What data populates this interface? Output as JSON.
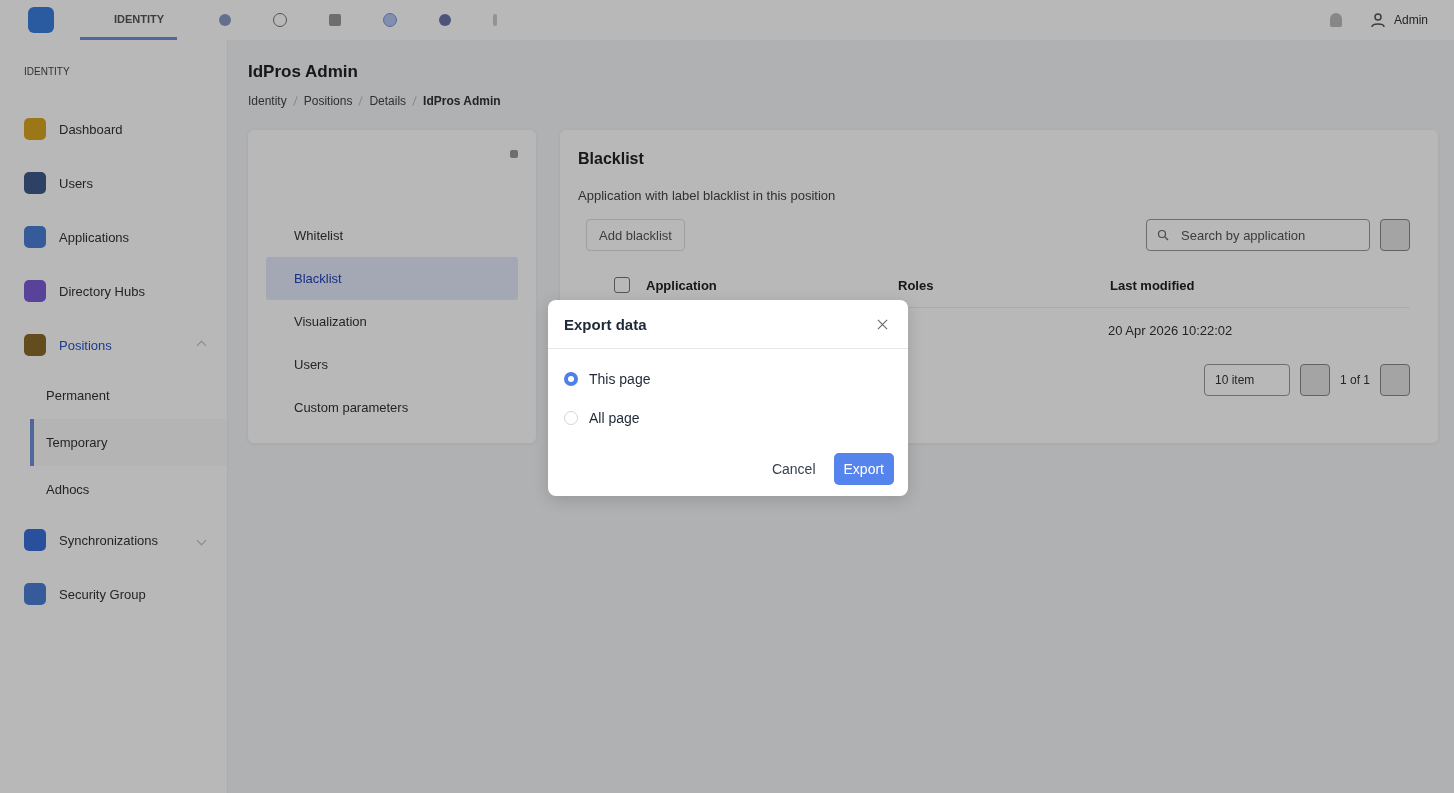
{
  "topbar": {
    "tabs": [
      {
        "label": "IDENTITY",
        "selected": true
      }
    ],
    "user": "Admin"
  },
  "sidebar": {
    "section": "IDENTITY",
    "items": [
      {
        "label": "Dashboard",
        "selected": false
      },
      {
        "label": "Users",
        "selected": false
      },
      {
        "label": "Applications",
        "selected": false
      },
      {
        "label": "Directory Hubs",
        "selected": false
      },
      {
        "label": "Positions",
        "selected": true,
        "expanded": true,
        "children": [
          {
            "label": "Permanent",
            "selected": false
          },
          {
            "label": "Temporary",
            "selected": true
          },
          {
            "label": "Adhocs",
            "selected": false
          }
        ]
      },
      {
        "label": "Synchronizations",
        "selected": false,
        "expanded": false
      },
      {
        "label": "Security Group",
        "selected": false
      }
    ]
  },
  "page": {
    "title": "IdPros Admin",
    "breadcrumb": [
      "Identity",
      "Positions",
      "Details",
      "IdPros Admin"
    ]
  },
  "detail_menu": {
    "items": [
      {
        "label": "Whitelist",
        "selected": false
      },
      {
        "label": "Blacklist",
        "selected": true
      },
      {
        "label": "Visualization",
        "selected": false
      },
      {
        "label": "Users",
        "selected": false
      },
      {
        "label": "Custom parameters",
        "selected": false
      }
    ]
  },
  "blacklist": {
    "title": "Blacklist",
    "subtitle": "Application with label blacklist in this position",
    "add_button": "Add blacklist",
    "search": {
      "placeholder": "Search by application"
    },
    "table": {
      "select_all": {
        "checked": false
      },
      "columns": [
        "Application",
        "Roles",
        "Last modified"
      ],
      "rows": [
        {
          "last_modified": "20 Apr 2026 10:22:02"
        }
      ]
    },
    "pagination": {
      "page_size": "10 item",
      "pages": "1 of 1"
    }
  },
  "dialog": {
    "title": "Export data",
    "options": [
      {
        "label": "This page",
        "selected": true
      },
      {
        "label": "All page",
        "selected": false
      }
    ],
    "buttons": [
      {
        "label": "Cancel",
        "kind": "text"
      },
      {
        "label": "Export",
        "kind": "primary"
      }
    ]
  }
}
